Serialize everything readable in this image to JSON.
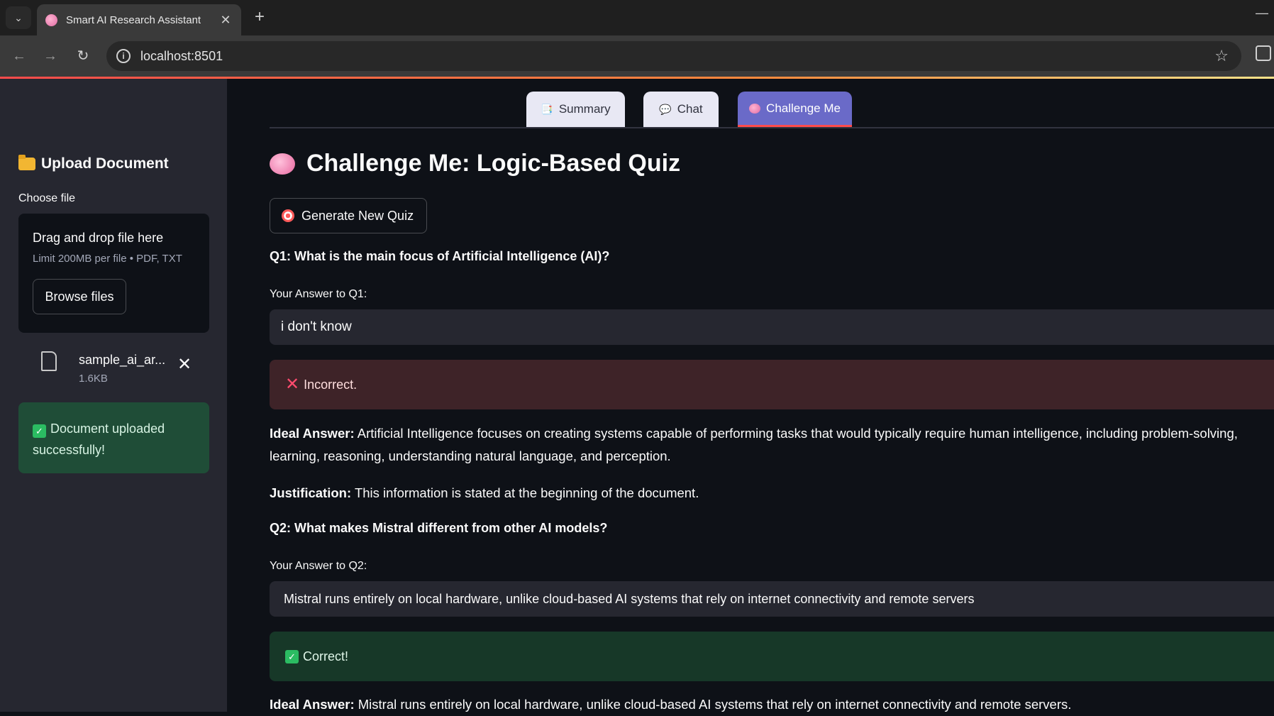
{
  "browser": {
    "tab_title": "Smart AI Research Assistant",
    "url": "localhost:8501"
  },
  "sidebar": {
    "heading": "Upload Document",
    "file_label": "Choose file",
    "dropzone_title": "Drag and drop file here",
    "dropzone_limit": "Limit 200MB per file • PDF, TXT",
    "browse_label": "Browse files",
    "file_name": "sample_ai_ar...",
    "file_size": "1.6KB",
    "success_message": "Document uploaded successfully!"
  },
  "tabs": [
    {
      "label": "Summary",
      "icon": "document-icon",
      "active": false
    },
    {
      "label": "Chat",
      "icon": "speech-bubble-icon",
      "active": false
    },
    {
      "label": "Challenge Me",
      "icon": "brain-icon",
      "active": true
    }
  ],
  "main": {
    "title": "Challenge Me: Logic-Based Quiz",
    "generate_label": "Generate New Quiz",
    "questions": [
      {
        "question": "Q1: What is the main focus of Artificial Intelligence (AI)?",
        "answer_label": "Your Answer to Q1:",
        "answer_value": "i don't know",
        "result": "Incorrect.",
        "ideal_label": "Ideal Answer:",
        "ideal_text": "Artificial Intelligence focuses on creating systems capable of performing tasks that would typically require human intelligence, including problem-solving, learning, reasoning, understanding natural language, and perception.",
        "justification_label": "Justification:",
        "justification_text": "This information is stated at the beginning of the document."
      },
      {
        "question": "Q2: What makes Mistral different from other AI models?",
        "answer_label": "Your Answer to Q2:",
        "answer_value": "Mistral runs entirely on local hardware, unlike cloud-based AI systems that rely on internet connectivity and remote servers",
        "result": "Correct!",
        "ideal_label": "Ideal Answer:",
        "ideal_text": "Mistral runs entirely on local hardware, unlike cloud-based AI systems that rely on internet connectivity and remote servers."
      }
    ]
  },
  "colors": {
    "accent": "#ff4b4b",
    "active_tab": "#6a6ac8",
    "error_bg": "#3e2328",
    "success_bg": "#173828"
  }
}
